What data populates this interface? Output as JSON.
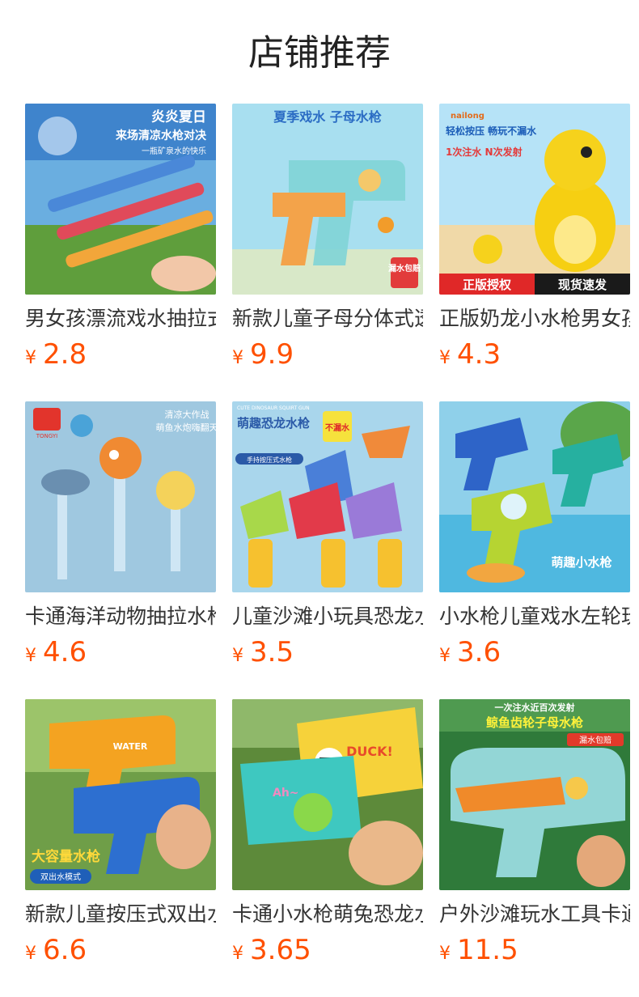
{
  "header": {
    "title": "店铺推荐"
  },
  "currency_symbol": "¥",
  "products": [
    {
      "name": "男女孩漂流戏水抽拉式水枪",
      "price": "2.8",
      "banner": "炎炎夏日",
      "sub": "来场清凉水枪对决",
      "tag": "一瓶矿泉水的快乐",
      "bg": "#5aa0d8",
      "accent": "#e2343c"
    },
    {
      "name": "新款儿童子母分体式透明水枪",
      "price": "9.9",
      "banner": "夏季戏水 子母水枪",
      "tag": "漏水包赔",
      "bg": "#a8dff0",
      "accent": "#f39a2a"
    },
    {
      "name": "正版奶龙小水枪男女孩玩具",
      "price": "4.3",
      "banner": "轻松按压 畅玩不漏水",
      "sub": "1次注水 N次发射",
      "badge_left": "正版授权",
      "badge_right": "现货速发",
      "brand": "nailong",
      "bg": "#b6e3f7",
      "accent": "#f6c400"
    },
    {
      "name": "卡通海洋动物抽拉水枪玩具",
      "price": "4.6",
      "banner": "清凉大作战",
      "sub": "萌鱼水炮嗨翻天",
      "brand": "TONGYI",
      "bg": "#9fc8e0",
      "accent": "#f08a32"
    },
    {
      "name": "儿童沙滩小玩具恐龙水枪",
      "price": "3.5",
      "banner": "萌趣恐龙水枪",
      "sub": "手持按压式水枪",
      "tag": "不漏水",
      "en": "CUTE DINOSAUR SQUIRT GUN",
      "bg": "#a9d6ec",
      "accent": "#f5c12f"
    },
    {
      "name": "小水枪儿童戏水左轮玩具",
      "price": "3.6",
      "banner": "萌趣小水枪",
      "bg": "#78c6e6",
      "accent": "#2e7ad0"
    },
    {
      "name": "新款儿童按压式双出水枪",
      "price": "6.6",
      "banner": "大容量水枪",
      "sub": "双出水模式",
      "en": "WATER",
      "bg": "#5f8f3a",
      "accent": "#f4a321"
    },
    {
      "name": "卡通小水枪萌兔恐龙水枪",
      "price": "3.65",
      "banner": "DUCK!",
      "sub": "Ah~",
      "bg": "#5d8a3a",
      "accent": "#f6d23a"
    },
    {
      "name": "户外沙滩玩水工具卡通水枪",
      "price": "11.5",
      "banner": "一次注水近百次发射",
      "sub": "鲸鱼齿轮子母水枪",
      "tag": "漏水包赔",
      "bg": "#2f7a3a",
      "accent": "#f08a2a"
    }
  ]
}
